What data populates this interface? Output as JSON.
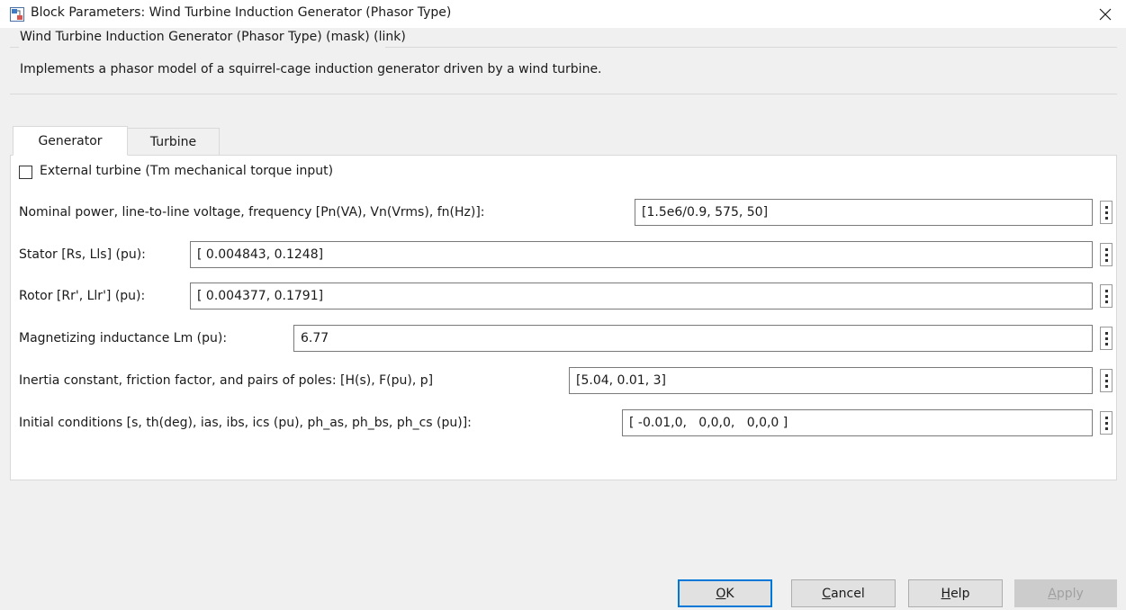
{
  "window": {
    "title": "Block Parameters: Wind Turbine Induction Generator (Phasor Type)"
  },
  "mask": {
    "heading": "Wind Turbine Induction Generator (Phasor Type) (mask) (link)",
    "description": "Implements a phasor model of a squirrel-cage induction generator driven by a wind turbine."
  },
  "tabs": [
    {
      "label": "Generator",
      "active": true
    },
    {
      "label": "Turbine",
      "active": false
    }
  ],
  "checkbox": {
    "label": "External turbine (Tm mechanical torque input)",
    "checked": false
  },
  "params": [
    {
      "label": "Nominal power, line-to-line voltage, frequency [Pn(VA), Vn(Vrms), fn(Hz)]:",
      "value": "[1.5e6/0.9, 575, 50]"
    },
    {
      "label": "Stator [Rs, Lls] (pu):",
      "value": "[ 0.004843, 0.1248]"
    },
    {
      "label": "Rotor [Rr', Llr'] (pu):",
      "value": "[ 0.004377, 0.1791]"
    },
    {
      "label": "Magnetizing inductance Lm (pu):",
      "value": "6.77"
    },
    {
      "label": "Inertia constant, friction factor, and pairs of poles: [H(s), F(pu), p]",
      "value": "[5.04, 0.01, 3]"
    },
    {
      "label": "Initial conditions [s, th(deg), ias, ibs, ics (pu), ph_as, ph_bs, ph_cs (pu)]:",
      "value": "[ -0.01,0,   0,0,0,   0,0,0 ]"
    }
  ],
  "buttons": {
    "ok": {
      "mnemonic": "O",
      "rest": "K"
    },
    "cancel": {
      "mnemonic": "C",
      "rest": "ancel"
    },
    "help": {
      "mnemonic": "H",
      "rest": "elp"
    },
    "apply": {
      "mnemonic": "A",
      "rest": "pply"
    }
  },
  "icons": {
    "title": "simulink-block-icon",
    "close": "close-icon",
    "more": "kebab-menu-icon"
  },
  "colors": {
    "background": "#f0f0f0",
    "panel": "#ffffff",
    "focus": "#0078d7",
    "disabled_text": "#a0a0a0"
  }
}
